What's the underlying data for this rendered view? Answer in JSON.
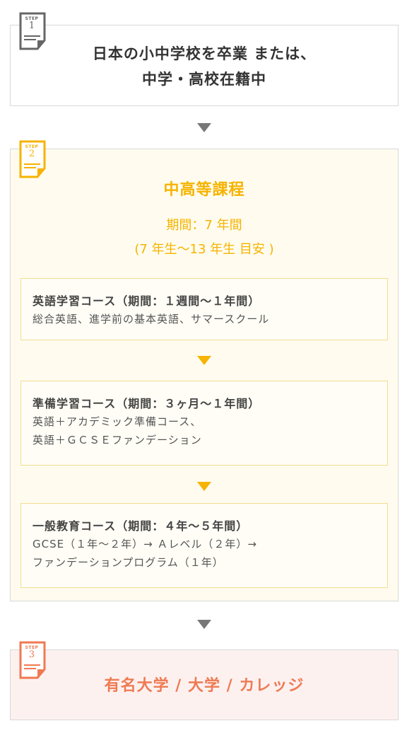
{
  "steps": [
    {
      "step_label": "STEP",
      "number": "1",
      "title_line1": "日本の小中学校を卒業 または、",
      "title_line2": "中学・高校在籍中",
      "badge_color": "#666666"
    },
    {
      "step_label": "STEP",
      "number": "2",
      "title": "中高等課程",
      "period": "期間：7 年間",
      "age": "(7 年生〜13 年生 目安 )",
      "badge_color": "#f6b300",
      "courses": [
        {
          "title": "英語学習コース（期間：１週間〜１年間）",
          "desc_line1": "総合英語、進学前の基本英語、サマースクール"
        },
        {
          "title": "準備学習コース（期間：３ヶ月〜１年間）",
          "desc_line1": "英語＋アカデミック準備コース、",
          "desc_line2": "英語＋ＧＣＳＥファンデーション"
        },
        {
          "title": "一般教育コース（期間：４年〜５年間）",
          "desc_line1": "GCSE（１年〜２年）→ Ａレベル（２年）→",
          "desc_line2": "ファンデーションプログラム（１年）"
        }
      ]
    },
    {
      "step_label": "STEP",
      "number": "3",
      "title": "有名大学 / 大学 / カレッジ",
      "badge_color": "#ef7a52"
    }
  ],
  "colors": {
    "accent_yellow": "#f6b300",
    "accent_orange": "#ef7a52",
    "step2_bg": "#fffcef",
    "step3_bg": "#fdf1f0"
  }
}
